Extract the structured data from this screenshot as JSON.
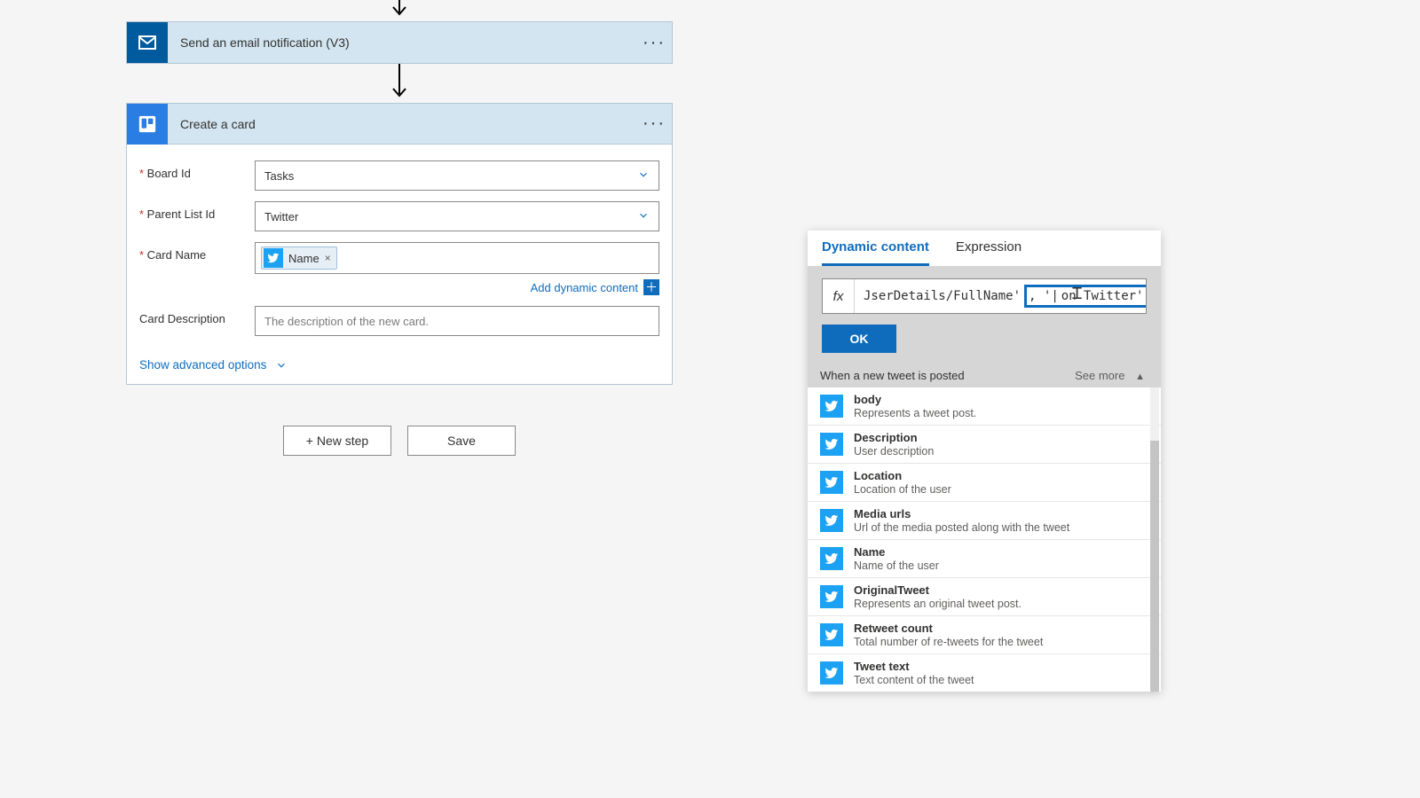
{
  "flow": {
    "step_email": {
      "title": "Send an email notification (V3)"
    },
    "step_trello": {
      "title": "Create a card",
      "fields": {
        "board_id": {
          "label": "Board Id",
          "value": "Tasks"
        },
        "parent_list_id": {
          "label": "Parent List Id",
          "value": "Twitter"
        },
        "card_name": {
          "label": "Card Name",
          "token_label": "Name"
        },
        "card_desc": {
          "label": "Card Description",
          "placeholder": "The description of the new card."
        }
      },
      "add_dynamic_content": "Add dynamic content",
      "show_advanced": "Show advanced options"
    }
  },
  "footer": {
    "new_step": "+ New step",
    "save": "Save"
  },
  "dyn": {
    "tab_dynamic": "Dynamic content",
    "tab_expression": "Expression",
    "expr_left": "JserDetails/FullName'",
    "expr_sep": ", '",
    "expr_cursor_pre": "|",
    "expr_right": "n Twitter')",
    "fx": "fx",
    "ok": "OK",
    "section_title": "When a new tweet is posted",
    "see_more": "See more",
    "items": [
      {
        "title": "body",
        "desc": "Represents a tweet post."
      },
      {
        "title": "Description",
        "desc": "User description"
      },
      {
        "title": "Location",
        "desc": "Location of the user"
      },
      {
        "title": "Media urls",
        "desc": "Url of the media posted along with the tweet"
      },
      {
        "title": "Name",
        "desc": "Name of the user"
      },
      {
        "title": "OriginalTweet",
        "desc": "Represents an original tweet post."
      },
      {
        "title": "Retweet count",
        "desc": "Total number of re-tweets for the tweet"
      },
      {
        "title": "Tweet text",
        "desc": "Text content of the tweet"
      }
    ]
  }
}
